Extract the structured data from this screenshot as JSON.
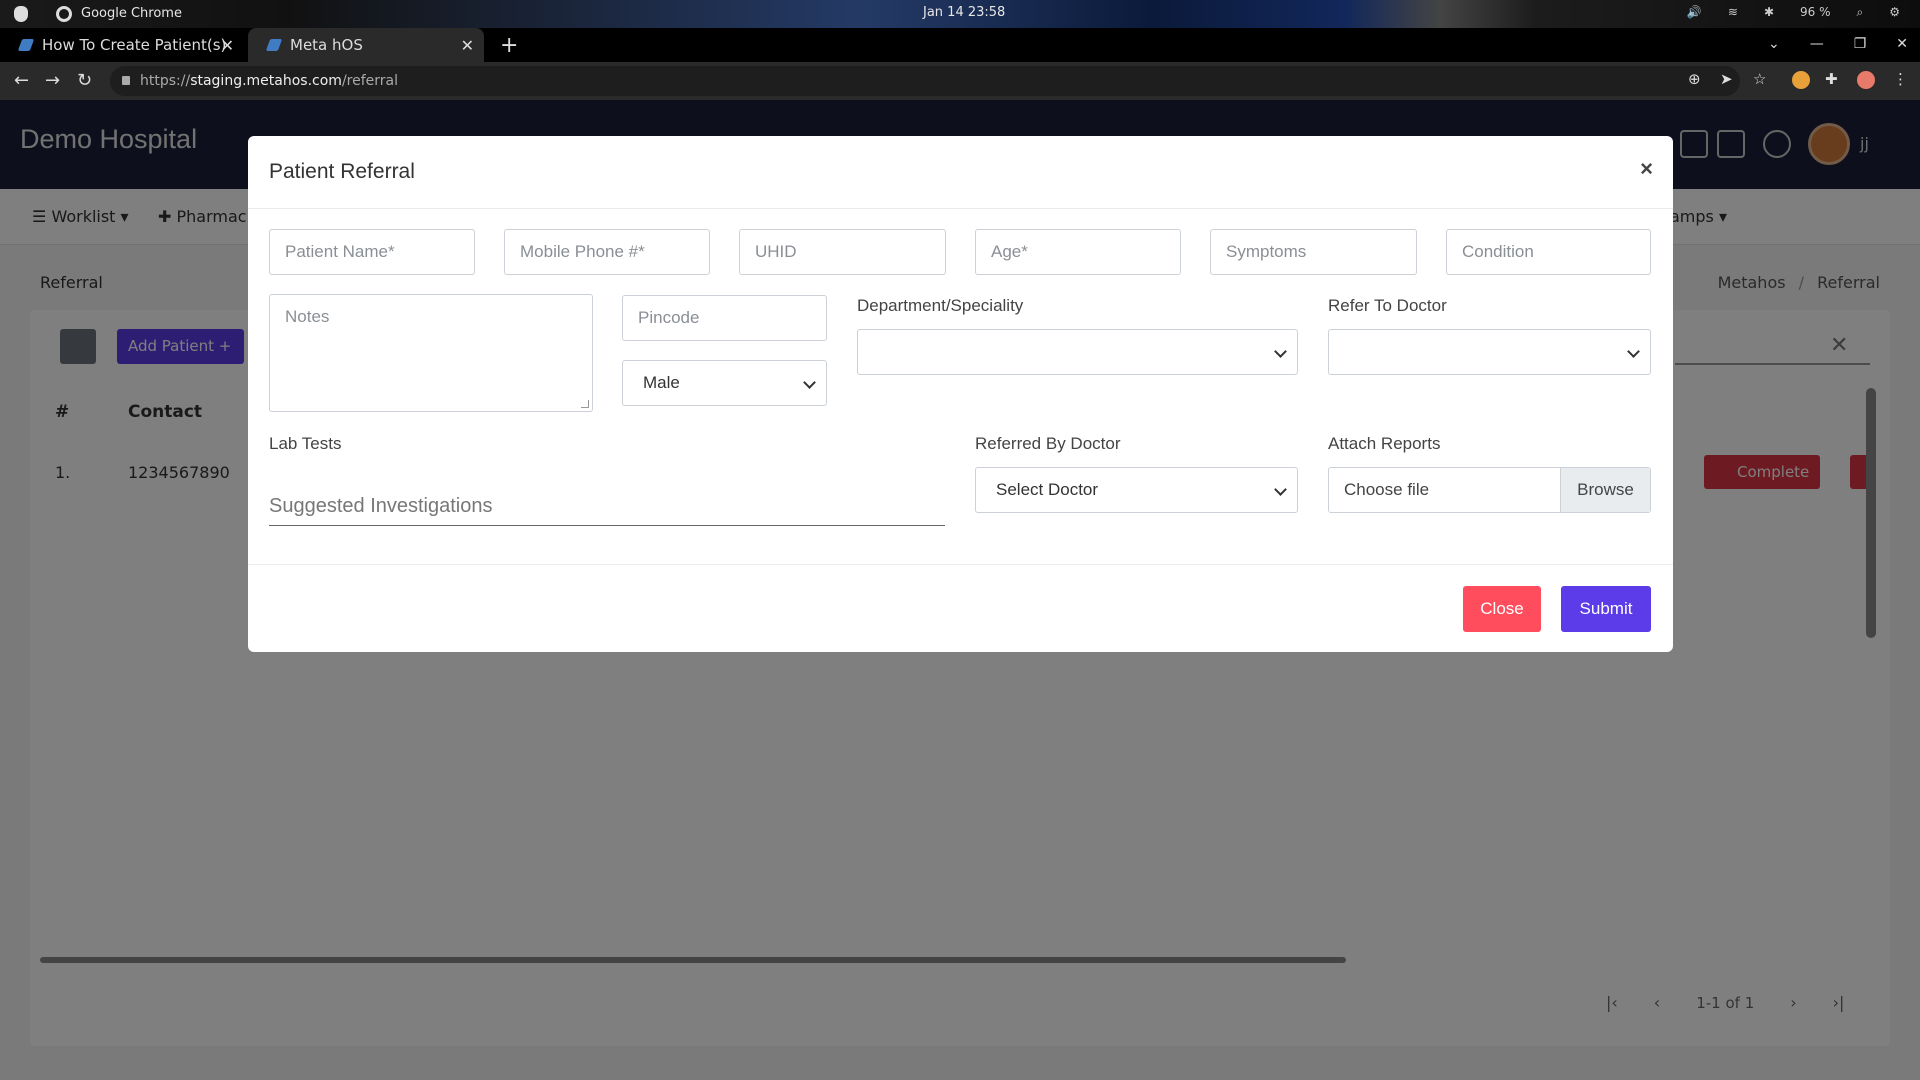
{
  "os": {
    "app_name": "Google Chrome",
    "clock": "Jan 14  23:58",
    "battery": "96 %"
  },
  "browser": {
    "tabs": [
      {
        "label": "How To Create Patient(s)"
      },
      {
        "label": "Meta hOS"
      }
    ],
    "url_prefix": "https://",
    "url_host": "staging.metahos.com",
    "url_path": "/referral"
  },
  "app": {
    "brand": "Demo Hospital",
    "user": "jj",
    "menu": {
      "worklist": "Worklist",
      "pharmacy": "Pharmac",
      "camps": "amps"
    },
    "page_title": "Referral",
    "breadcrumb": {
      "home": "Metahos",
      "sep": "/",
      "current": "Referral"
    },
    "add_patient": "Add Patient  +",
    "table": {
      "headers": [
        "#",
        "Contact"
      ],
      "rows": [
        {
          "num": "1.",
          "contact": "1234567890"
        }
      ]
    },
    "complete_label": "Complete",
    "pager": "1-1 of 1"
  },
  "modal": {
    "title": "Patient Referral",
    "close_icon": "×",
    "fields": {
      "patient_name": "Patient Name*",
      "mobile": "Mobile Phone #*",
      "uhid": "UHID",
      "age": "Age*",
      "symptoms": "Symptoms",
      "condition": "Condition",
      "notes": "Notes",
      "pincode": "Pincode",
      "gender": "Male"
    },
    "labels": {
      "department": "Department/Speciality",
      "refer_to": "Refer To Doctor",
      "lab_tests": "Lab Tests",
      "referred_by": "Referred By Doctor",
      "attach": "Attach Reports"
    },
    "lab_placeholder": "Suggested Investigations",
    "referred_by_value": "Select Doctor",
    "file_placeholder": "Choose file",
    "browse": "Browse",
    "close_btn": "Close",
    "submit_btn": "Submit"
  }
}
